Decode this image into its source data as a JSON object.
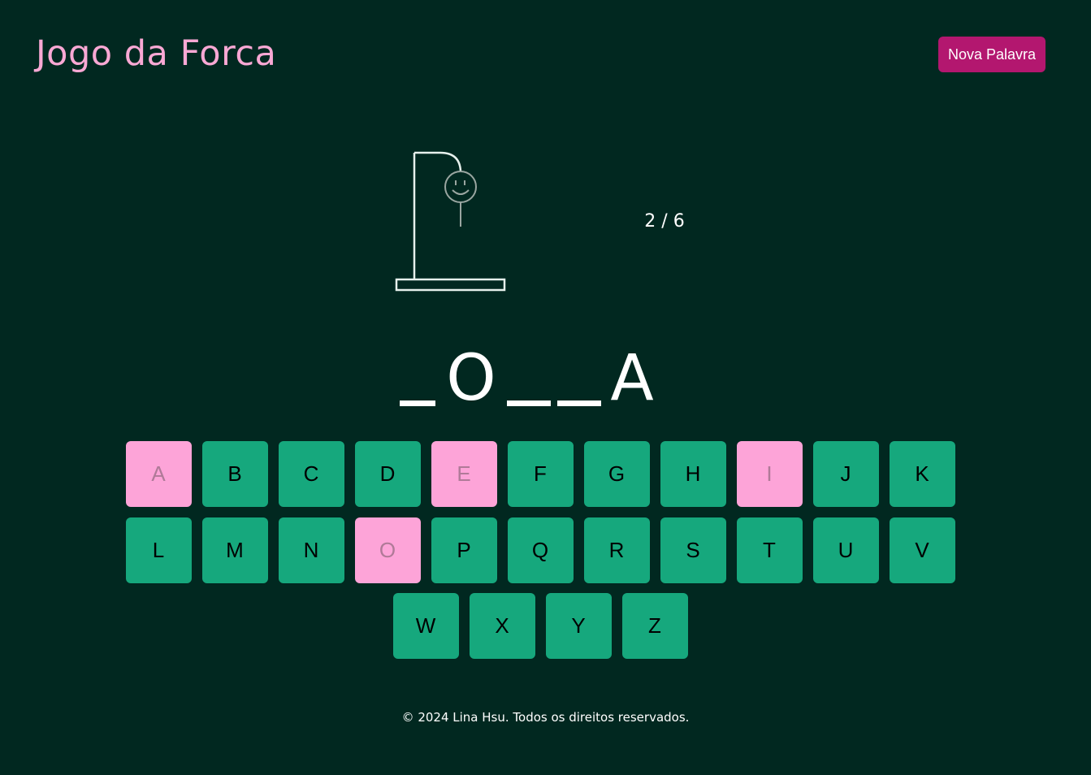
{
  "header": {
    "title": "Jogo da Forca",
    "new_word_label": "Nova Palavra"
  },
  "game": {
    "errors_text": "2 / 6",
    "errors": 2,
    "max_errors": 6,
    "word": [
      {
        "letter": "",
        "revealed": false
      },
      {
        "letter": "O",
        "revealed": true
      },
      {
        "letter": "",
        "revealed": false
      },
      {
        "letter": "",
        "revealed": false
      },
      {
        "letter": "A",
        "revealed": true
      }
    ]
  },
  "keyboard": {
    "rows": [
      [
        "A",
        "B",
        "C",
        "D",
        "E",
        "F",
        "G",
        "H",
        "I",
        "J",
        "K"
      ],
      [
        "L",
        "M",
        "N",
        "O",
        "P",
        "Q",
        "R",
        "S",
        "T",
        "U",
        "V"
      ],
      [
        "W",
        "X",
        "Y",
        "Z"
      ]
    ],
    "used_letters": [
      "A",
      "E",
      "I",
      "O"
    ]
  },
  "colors": {
    "background": "#012820",
    "title": "#f9a8d4",
    "button": "#b3176f",
    "key": "#16a87d",
    "key_used": "#fda4d8"
  },
  "footer": {
    "text": "© 2024 Lina Hsu. Todos os direitos reservados."
  }
}
